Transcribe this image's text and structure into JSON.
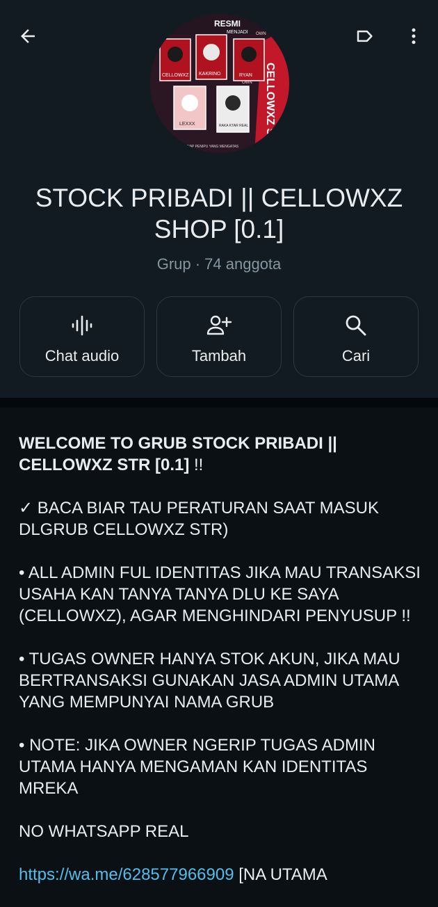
{
  "header": {
    "group_name": "STOCK PRIBADI || CELLOWXZ SHOP [0.1]",
    "meta": "Grup · 74 anggota"
  },
  "avatar_text": {
    "top": "RESMI",
    "sub": "MENJADI",
    "side": "CELLOWXZ STR",
    "card1": "CELLOWXZ",
    "card2": "KAKRINO",
    "card3": "RYAN",
    "card4": "LEXXX",
    "card5": "RAKA KTAR REAL",
    "own1": "OWN",
    "own2": "OWN",
    "bottom": "SIAP PENIPU YANG MENGATAS"
  },
  "actions": [
    {
      "label": "Chat audio",
      "icon": "audio-wave-icon"
    },
    {
      "label": "Tambah",
      "icon": "add-person-icon"
    },
    {
      "label": "Cari",
      "icon": "search-icon"
    }
  ],
  "description": {
    "welcome_bold": "WELCOME TO GRUB STOCK PRIBADI || CELLOWXZ STR [0.1]",
    "welcome_tail": " !!",
    "p1": "✓ BACA BIAR TAU PERATURAN SAAT MASUK DLGRUB CELLOWXZ STR)",
    "p2": "• ALL ADMIN FUL IDENTITAS JIKA MAU TRANSAKSI USAHA KAN TANYA TANYA DLU KE SAYA (CELLOWXZ), AGAR MENGHINDARI PENYUSUP !!",
    "p3": "• TUGAS OWNER HANYA STOK AKUN, JIKA MAU BERTRANSAKSI GUNAKAN JASA ADMIN UTAMA YANG MEMPUNYAI NAMA GRUB",
    "p4": "• NOTE: JIKA OWNER NGERIP TUGAS ADMIN UTAMA HANYA MENGAMAN KAN IDENTITAS MREKA",
    "p5": "NO WHATSAPP REAL",
    "p6_link": "https://wa.me/628577966909",
    "p6_tail": " [NA UTAMA"
  },
  "colors": {
    "background": "#0b1014",
    "header": "#121b22",
    "secondary_text": "#8696a0",
    "link": "#53bdeb"
  }
}
